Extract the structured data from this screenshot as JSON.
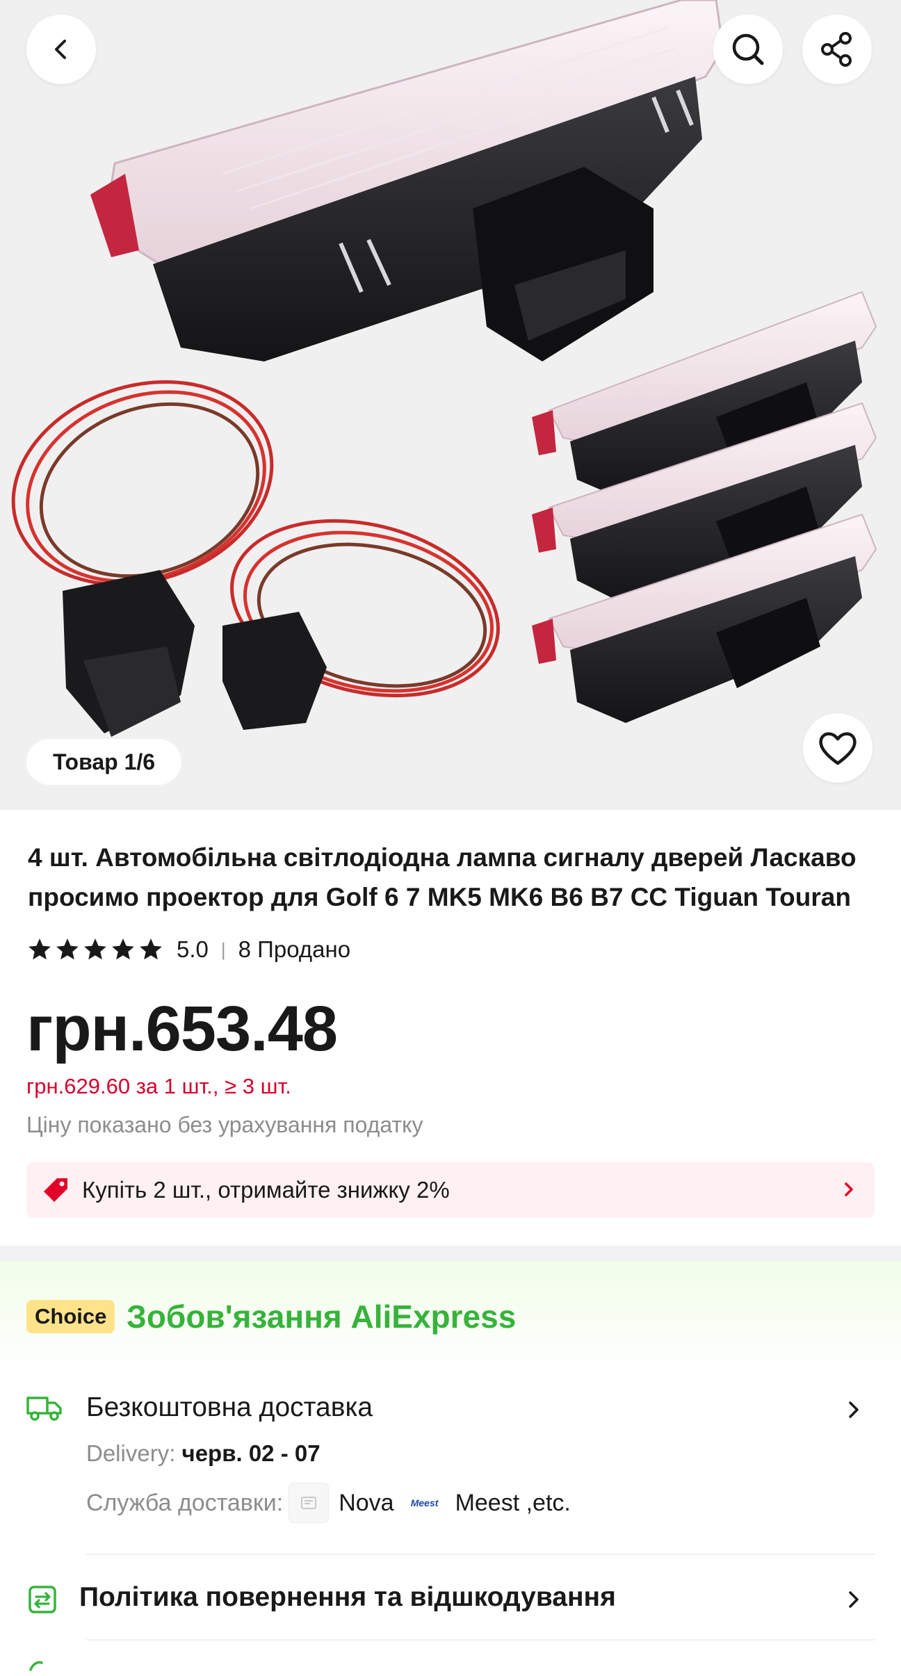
{
  "gallery": {
    "counter": "Товар 1/6",
    "icons": [
      "back-arrow-icon",
      "search-icon",
      "share-icon",
      "heart-icon"
    ]
  },
  "product": {
    "title": "4 шт. Автомобільна світлодіодна лампа сигналу дверей Ласкаво просимо проектор для Golf 6 7 MK5 MK6 B6 B7 CC Tiguan Touran",
    "rating": "5.0",
    "sold": "8 Продано",
    "price": "грн.653.48",
    "bulk_price": "грн.629.60 за 1 шт., ≥ 3 шт.",
    "tax_note": "Ціну показано без урахування податку",
    "promo": "Купіть 2 шт., отримайте знижку 2%"
  },
  "choice": {
    "badge": "Choice",
    "title": "Зобов'язання AliExpress"
  },
  "shipping": {
    "title": "Безкоштовна доставка",
    "delivery_label": "Delivery: ",
    "delivery_dates": "черв. 02 - 07",
    "service_label": "Служба доставки:",
    "carrier1": "Nova",
    "carrier2_logo": "Meest",
    "carrier2": "Meest ,etc."
  },
  "returns": {
    "title": "Політика повернення та відшкодування"
  },
  "colors": {
    "price_red": "#d6002d",
    "choice_green": "#36b33a",
    "choice_badge": "#ffe38a",
    "promo_bg": "#fff0f2"
  }
}
